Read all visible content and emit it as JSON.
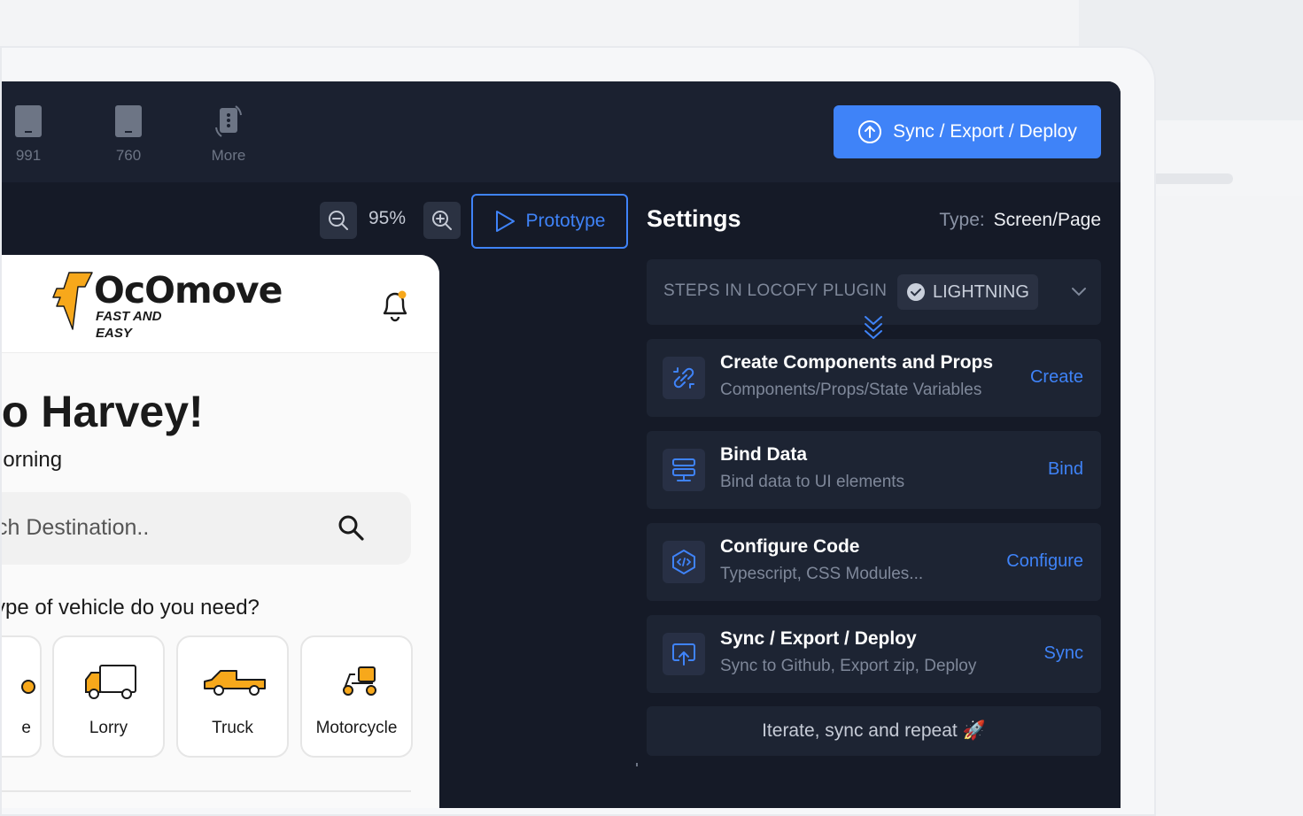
{
  "toolbar": {
    "devices": [
      {
        "label": "991",
        "icon": "tablet-icon"
      },
      {
        "label": "760",
        "icon": "tablet-icon"
      },
      {
        "label": "More",
        "icon": "more-devices-icon"
      }
    ],
    "sync_label": "Sync / Export / Deploy"
  },
  "canvas": {
    "zoom": "95%",
    "prototype_label": "Prototype"
  },
  "settings": {
    "title": "Settings",
    "type_label": "Type:",
    "type_value": "Screen/Page",
    "steps_label": "STEPS IN LOCOFY PLUGIN",
    "mode_badge": "LIGHTNING",
    "steps": [
      {
        "title": "Create Components and Props",
        "subtitle": "Components/Props/State Variables",
        "action": "Create",
        "icon": "link-icon"
      },
      {
        "title": "Bind Data",
        "subtitle": "Bind data to UI elements",
        "action": "Bind",
        "icon": "database-icon"
      },
      {
        "title": "Configure Code",
        "subtitle": "Typescript, CSS Modules...",
        "action": "Configure",
        "icon": "code-icon"
      },
      {
        "title": "Sync / Export / Deploy",
        "subtitle": "Sync to Github, Export zip, Deploy",
        "action": "Sync",
        "icon": "upload-screen-icon"
      }
    ],
    "footer": "Iterate, sync and repeat",
    "footer_emoji": "🚀"
  },
  "preview": {
    "logo_text": "OcOmove",
    "logo_tagline_1": "FAST AND",
    "logo_tagline_2": "EASY",
    "greeting": "llo Harvey!",
    "subgreeting": "norning",
    "search_placeholder": "ch Destination..",
    "question": "ype of vehicle do you need?",
    "vehicles": [
      "e",
      "Lorry",
      "Truck",
      "Motorcycle"
    ]
  },
  "colors": {
    "accent": "#3f83f8",
    "app_bg": "#151a27",
    "panel_bg": "#1d2433",
    "logo_orange": "#f7a81b"
  }
}
